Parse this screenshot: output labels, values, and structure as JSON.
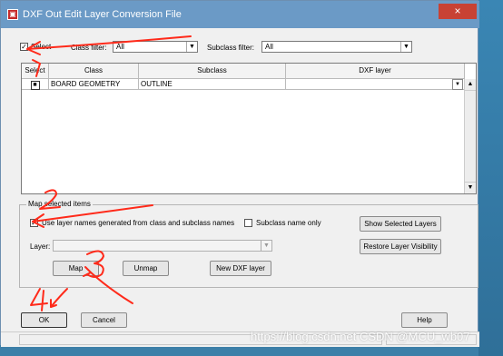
{
  "window": {
    "title": "DXF Out Edit Layer Conversion File",
    "close_label": "×"
  },
  "filter": {
    "select_label": "Select",
    "class_filter_label": "Class filter:",
    "class_filter_value": "All",
    "subclass_filter_label": "Subclass filter:",
    "subclass_filter_value": "All"
  },
  "grid": {
    "columns": [
      "Select",
      "Class",
      "Subclass",
      "DXF layer"
    ],
    "rows": [
      {
        "selected": true,
        "class": "BOARD GEOMETRY",
        "subclass": "OUTLINE",
        "dxf_layer": ""
      }
    ]
  },
  "map_group": {
    "title": "Map selected items",
    "use_names_label": "Use layer names generated from class and subclass names",
    "use_names_checked": true,
    "subclass_only_label": "Subclass name only",
    "subclass_only_checked": false,
    "layer_label": "Layer:",
    "layer_value": "",
    "map_button": "Map",
    "unmap_button": "Unmap",
    "new_layer_button": "New DXF layer",
    "show_selected_button": "Show Selected Layers",
    "restore_visibility_button": "Restore Layer Visibility"
  },
  "footer": {
    "ok": "OK",
    "cancel": "Cancel",
    "help": "Help"
  },
  "watermark": "https://blog.csdn.net CSDN @MCU_wb07",
  "annotations": {
    "color": "#ff2a1a",
    "labels": [
      "1",
      "2",
      "3",
      "4"
    ]
  }
}
